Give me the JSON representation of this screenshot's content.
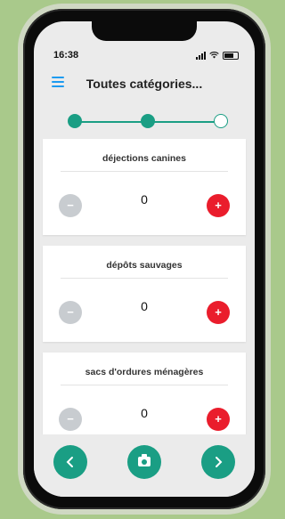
{
  "status_bar": {
    "time": "16:38"
  },
  "header": {
    "title": "Toutes catégories...",
    "menu_icon": "hamburger-menu-icon"
  },
  "colors": {
    "accent": "#1a9e84",
    "plus": "#ea1d2c",
    "minus": "#c8ccd0",
    "menu": "#1d9bf0"
  },
  "steps": {
    "total": 3,
    "completed": 2
  },
  "categories": [
    {
      "name": "déjections canines",
      "count": "0"
    },
    {
      "name": "dépôts sauvages",
      "count": "0"
    },
    {
      "name": "sacs d'ordures ménagères",
      "count": "0"
    }
  ],
  "controls": {
    "minus_symbol": "−",
    "plus_symbol": "+"
  },
  "bottom_bar": {
    "back_icon": "chevron-left-icon",
    "camera_icon": "camera-icon",
    "next_icon": "chevron-right-icon"
  }
}
